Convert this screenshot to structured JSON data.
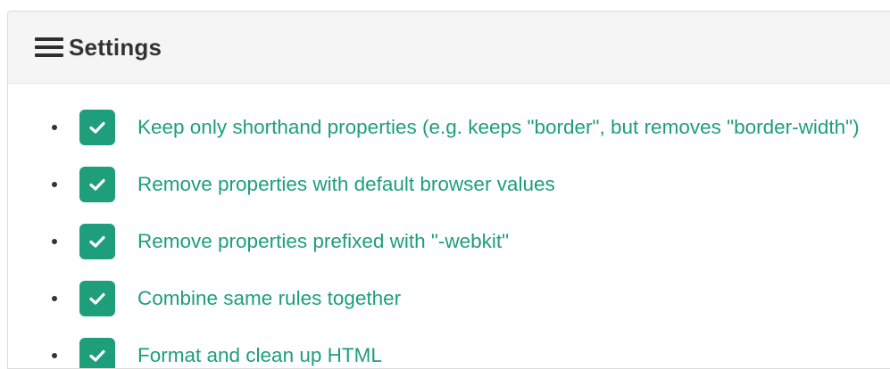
{
  "panel": {
    "title": "Settings",
    "title_icon": "menu-icon"
  },
  "settings": [
    {
      "label": "Keep only shorthand properties (e.g. keeps \"border\", but removes \"border-width\")",
      "checked": true
    },
    {
      "label": "Remove properties with default browser values",
      "checked": true
    },
    {
      "label": "Remove properties prefixed with \"-webkit\"",
      "checked": true
    },
    {
      "label": "Combine same rules together",
      "checked": true
    },
    {
      "label": "Format and clean up HTML",
      "checked": true
    }
  ],
  "colors": {
    "accent": "#1e9e7a",
    "header_bg": "#f5f5f5",
    "title_text": "#333333"
  }
}
